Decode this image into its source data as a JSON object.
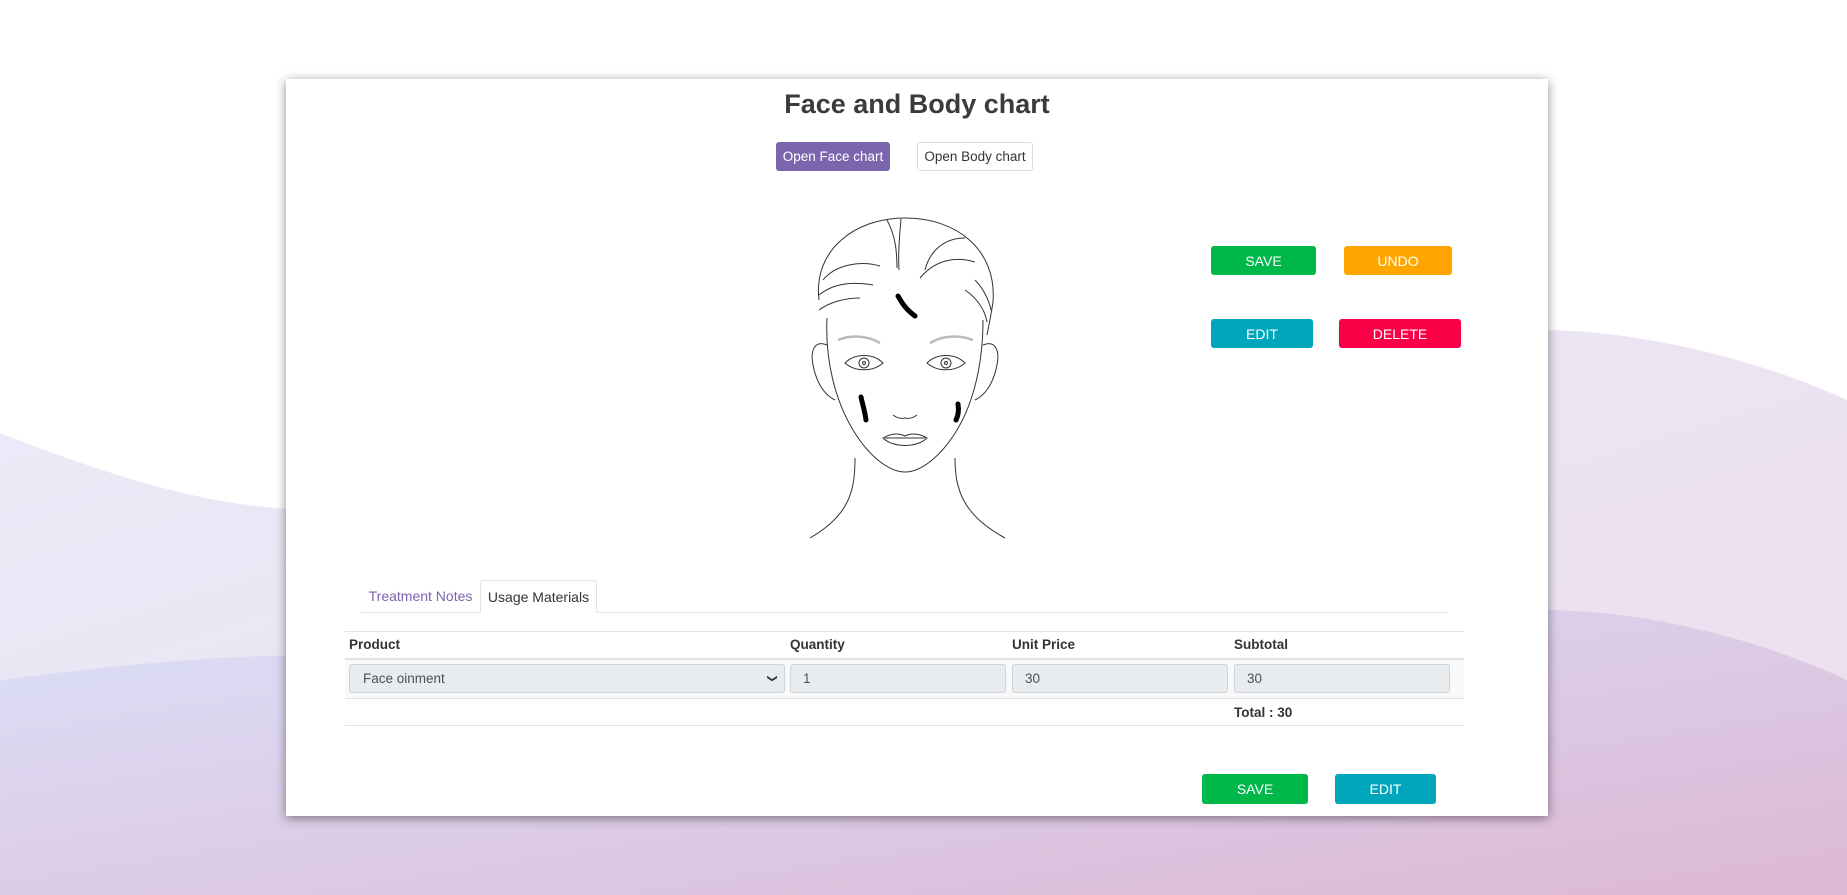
{
  "page": {
    "title": "Face and Body chart"
  },
  "chart_toggle": {
    "face_label": "Open Face chart",
    "body_label": "Open Body chart",
    "active": "face"
  },
  "face_chart": {
    "image": "face-outline-drawing",
    "marks": 3
  },
  "actions": {
    "save_label": "SAVE",
    "undo_label": "UNDO",
    "edit_label": "EDIT",
    "delete_label": "DELETE"
  },
  "tabs": [
    {
      "label": "Treatment Notes",
      "active": false
    },
    {
      "label": "Usage Materials",
      "active": true
    }
  ],
  "materials_table": {
    "headers": [
      "Product",
      "Quantity",
      "Unit Price",
      "Subtotal"
    ],
    "rows": [
      {
        "product": "Face oinment",
        "quantity": "1",
        "unit_price": "30",
        "subtotal": "30"
      }
    ],
    "total_label": "Total : 30"
  },
  "footer": {
    "save_label": "SAVE",
    "edit_label": "EDIT"
  },
  "colors": {
    "primary_purple": "#7b65ad",
    "save_green": "#00b84a",
    "undo_orange": "#ffa500",
    "edit_teal": "#00a6bb",
    "delete_red": "#fa0046"
  }
}
